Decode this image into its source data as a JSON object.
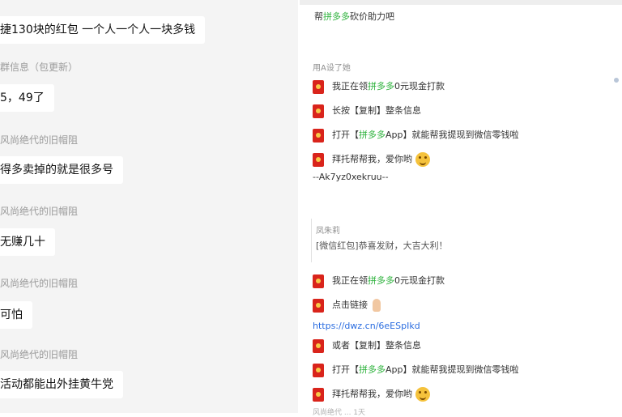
{
  "left_messages": [
    {
      "text": "捷130块的红包 一个人一个人一块多钱"
    },
    {
      "sender": "群信息（包更新）",
      "text": "5，49了"
    },
    {
      "sender": "风尚绝代的旧帽阻",
      "text": "得多卖掉的就是很多号"
    },
    {
      "sender": "风尚绝代的旧帽阻",
      "text": "无赚几十"
    },
    {
      "sender": "风尚绝代的旧帽阻",
      "text": "可怕"
    },
    {
      "sender": "风尚绝代的旧帽阻",
      "text": "活动都能出外挂黄牛党"
    }
  ],
  "right_panel": {
    "top_line": {
      "pre": "帮",
      "highlight": "拼多多",
      "post": "砍价助力吧"
    },
    "message1": {
      "sender": "用A设了她",
      "lines": [
        {
          "pre": "我正在领",
          "highlight": "拼多多",
          "post": "0元现金打款"
        },
        {
          "pre": "长按【复制】整条信息",
          "highlight": "",
          "post": ""
        },
        {
          "pre": "打开【",
          "highlight": "拼多多",
          "post": "App】就能帮我提现到微信零钱啦"
        },
        {
          "pre": "拜托帮帮我，爱你哟",
          "highlight": "",
          "post": ""
        }
      ],
      "code": "--Ak7yz0xekruu--"
    },
    "message2": {
      "sender": "凤朱莉",
      "quote": "[微信红包]恭喜发财，大吉大利！",
      "lines": [
        {
          "pre": "我正在领",
          "highlight": "拼多多",
          "post": "0元现金打款"
        },
        {
          "pre": "点击链接",
          "highlight": "",
          "post": ""
        }
      ],
      "link": "https://dwz.cn/6eESpIkd",
      "lines2": [
        {
          "pre": "或者【复制】整条信息",
          "highlight": "",
          "post": ""
        },
        {
          "pre": "打开【",
          "highlight": "拼多多",
          "post": "App】就能帮我提现到微信零钱啦"
        },
        {
          "pre": "拜托帮帮我，爱你哟",
          "highlight": "",
          "post": ""
        }
      ]
    },
    "bottom_meta": "风尚绝代 ... 1天"
  },
  "icons": {
    "envelope": "red-envelope-icon",
    "emoji": "smile-emoji-icon",
    "finger": "pointing-finger-icon"
  },
  "colors": {
    "highlight": "#2bb13a",
    "envelope": "#d9241b",
    "link": "#2b6de0"
  }
}
